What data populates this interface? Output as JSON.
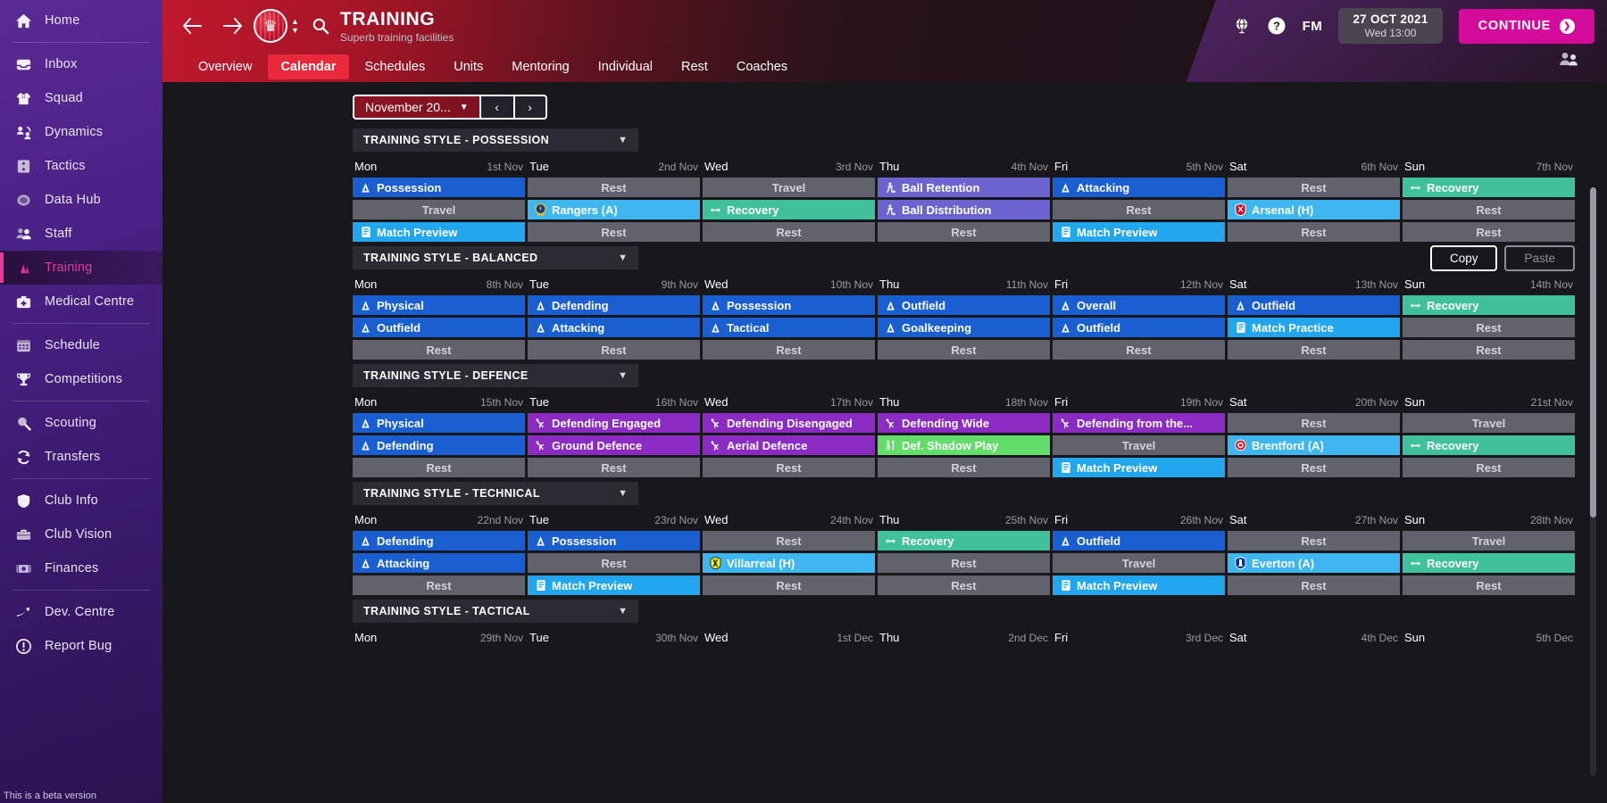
{
  "sidebar": {
    "items": [
      {
        "label": "Home",
        "icon": "home-icon",
        "active": false
      },
      {
        "divider": true
      },
      {
        "label": "Inbox",
        "icon": "inbox-icon",
        "active": false
      },
      {
        "label": "Squad",
        "icon": "shirt-icon",
        "active": false
      },
      {
        "label": "Dynamics",
        "icon": "dynamics-icon",
        "active": false
      },
      {
        "label": "Tactics",
        "icon": "tactics-icon",
        "active": false
      },
      {
        "label": "Data Hub",
        "icon": "datahub-icon",
        "active": false
      },
      {
        "label": "Staff",
        "icon": "staff-icon",
        "active": false
      },
      {
        "label": "Training",
        "icon": "training-icon",
        "active": true
      },
      {
        "label": "Medical Centre",
        "icon": "medical-icon",
        "active": false
      },
      {
        "divider": true
      },
      {
        "label": "Schedule",
        "icon": "calendar-icon",
        "active": false
      },
      {
        "label": "Competitions",
        "icon": "trophy-icon",
        "active": false
      },
      {
        "divider": true
      },
      {
        "label": "Scouting",
        "icon": "magnifier-icon",
        "active": false
      },
      {
        "label": "Transfers",
        "icon": "transfer-icon",
        "active": false
      },
      {
        "divider": true
      },
      {
        "label": "Club Info",
        "icon": "shield-icon",
        "active": false
      },
      {
        "label": "Club Vision",
        "icon": "briefcase-icon",
        "active": false
      },
      {
        "label": "Finances",
        "icon": "money-icon",
        "active": false
      },
      {
        "divider": true
      },
      {
        "label": "Dev. Centre",
        "icon": "growth-icon",
        "active": false
      },
      {
        "label": "Report Bug",
        "icon": "bug-icon",
        "active": false
      }
    ],
    "beta_note": "This is a beta version"
  },
  "header": {
    "back_icon": "back-arrow-icon",
    "forward_icon": "forward-arrow-icon",
    "club_badge": "club-crest-icon",
    "search_icon": "search-icon",
    "title": "TRAINING",
    "subtitle": "Superb training facilities",
    "globe_icon": "globe-icon",
    "help_icon": "help-icon",
    "fm_logo": "FM",
    "date_main": "27 OCT 2021",
    "date_sub": "Wed 13:00",
    "continue_label": "CONTINUE",
    "continue_color": "#d40b9a",
    "people_icon": "people-icon",
    "tabs": [
      {
        "label": "Overview",
        "active": false
      },
      {
        "label": "Calendar",
        "active": true
      },
      {
        "label": "Schedules",
        "active": false
      },
      {
        "label": "Units",
        "active": false
      },
      {
        "label": "Mentoring",
        "active": false
      },
      {
        "label": "Individual",
        "active": false
      },
      {
        "label": "Rest",
        "active": false
      },
      {
        "label": "Coaches",
        "active": false
      }
    ]
  },
  "toolbar": {
    "month_value": "November 20...",
    "month_chevron": "chevron-down-icon",
    "prev_label": "‹",
    "next_label": "›",
    "copy_label": "Copy",
    "paste_label": "Paste"
  },
  "weeks": [
    {
      "title": "TRAINING STYLE - POSSESSION",
      "days": [
        {
          "dow": "Mon",
          "date": "1st Nov"
        },
        {
          "dow": "Tue",
          "date": "2nd Nov"
        },
        {
          "dow": "Wed",
          "date": "3rd Nov"
        },
        {
          "dow": "Thu",
          "date": "4th Nov"
        },
        {
          "dow": "Fri",
          "date": "5th Nov"
        },
        {
          "dow": "Sat",
          "date": "6th Nov"
        },
        {
          "dow": "Sun",
          "date": "7th Nov"
        }
      ],
      "columns": [
        [
          {
            "label": "Possession",
            "kind": "blue",
            "icon": "cone-icon"
          },
          {
            "label": "Travel",
            "kind": "travel",
            "icon": ""
          },
          {
            "label": "Match Preview",
            "kind": "preview",
            "icon": "clipboard-icon"
          }
        ],
        [
          {
            "label": "Rest",
            "kind": "rest",
            "icon": ""
          },
          {
            "label": "Rangers (A)",
            "kind": "match",
            "icon": "badge-rangers"
          },
          {
            "label": "Rest",
            "kind": "rest",
            "icon": ""
          }
        ],
        [
          {
            "label": "Travel",
            "kind": "travel",
            "icon": ""
          },
          {
            "label": "Recovery",
            "kind": "green",
            "icon": "recovery-icon"
          },
          {
            "label": "Rest",
            "kind": "rest",
            "icon": ""
          }
        ],
        [
          {
            "label": "Ball Retention",
            "kind": "purple",
            "icon": "player-icon"
          },
          {
            "label": "Ball Distribution",
            "kind": "purple",
            "icon": "player-icon"
          },
          {
            "label": "Rest",
            "kind": "rest",
            "icon": ""
          }
        ],
        [
          {
            "label": "Attacking",
            "kind": "blue",
            "icon": "cone-icon"
          },
          {
            "label": "Rest",
            "kind": "rest",
            "icon": ""
          },
          {
            "label": "Match Preview",
            "kind": "preview",
            "icon": "clipboard-icon"
          }
        ],
        [
          {
            "label": "Rest",
            "kind": "rest",
            "icon": ""
          },
          {
            "label": "Arsenal (H)",
            "kind": "match",
            "icon": "badge-arsenal"
          },
          {
            "label": "Rest",
            "kind": "rest",
            "icon": ""
          }
        ],
        [
          {
            "label": "Recovery",
            "kind": "green",
            "icon": "recovery-icon"
          },
          {
            "label": "Rest",
            "kind": "rest",
            "icon": ""
          },
          {
            "label": "Rest",
            "kind": "rest",
            "icon": ""
          }
        ]
      ]
    },
    {
      "title": "TRAINING STYLE - BALANCED",
      "days": [
        {
          "dow": "Mon",
          "date": "8th Nov"
        },
        {
          "dow": "Tue",
          "date": "9th Nov"
        },
        {
          "dow": "Wed",
          "date": "10th Nov"
        },
        {
          "dow": "Thu",
          "date": "11th Nov"
        },
        {
          "dow": "Fri",
          "date": "12th Nov"
        },
        {
          "dow": "Sat",
          "date": "13th Nov"
        },
        {
          "dow": "Sun",
          "date": "14th Nov"
        }
      ],
      "columns": [
        [
          {
            "label": "Physical",
            "kind": "blue",
            "icon": "cone-icon"
          },
          {
            "label": "Outfield",
            "kind": "blue",
            "icon": "cone-icon"
          },
          {
            "label": "Rest",
            "kind": "rest",
            "icon": ""
          }
        ],
        [
          {
            "label": "Defending",
            "kind": "blue",
            "icon": "cone-icon"
          },
          {
            "label": "Attacking",
            "kind": "blue",
            "icon": "cone-icon"
          },
          {
            "label": "Rest",
            "kind": "rest",
            "icon": ""
          }
        ],
        [
          {
            "label": "Possession",
            "kind": "blue",
            "icon": "cone-icon"
          },
          {
            "label": "Tactical",
            "kind": "blue",
            "icon": "cone-icon"
          },
          {
            "label": "Rest",
            "kind": "rest",
            "icon": ""
          }
        ],
        [
          {
            "label": "Outfield",
            "kind": "blue",
            "icon": "cone-icon"
          },
          {
            "label": "Goalkeeping",
            "kind": "blue",
            "icon": "cone-icon"
          },
          {
            "label": "Rest",
            "kind": "rest",
            "icon": ""
          }
        ],
        [
          {
            "label": "Overall",
            "kind": "blue",
            "icon": "cone-icon"
          },
          {
            "label": "Outfield",
            "kind": "blue",
            "icon": "cone-icon"
          },
          {
            "label": "Rest",
            "kind": "rest",
            "icon": ""
          }
        ],
        [
          {
            "label": "Outfield",
            "kind": "blue",
            "icon": "cone-icon"
          },
          {
            "label": "Match Practice",
            "kind": "practice",
            "icon": "clipboard-icon"
          },
          {
            "label": "Rest",
            "kind": "rest",
            "icon": ""
          }
        ],
        [
          {
            "label": "Recovery",
            "kind": "green",
            "icon": "recovery-icon"
          },
          {
            "label": "Rest",
            "kind": "rest",
            "icon": ""
          },
          {
            "label": "Rest",
            "kind": "rest",
            "icon": ""
          }
        ]
      ]
    },
    {
      "title": "TRAINING STYLE - DEFENCE",
      "days": [
        {
          "dow": "Mon",
          "date": "15th Nov"
        },
        {
          "dow": "Tue",
          "date": "16th Nov"
        },
        {
          "dow": "Wed",
          "date": "17th Nov"
        },
        {
          "dow": "Thu",
          "date": "18th Nov"
        },
        {
          "dow": "Fri",
          "date": "19th Nov"
        },
        {
          "dow": "Sat",
          "date": "20th Nov"
        },
        {
          "dow": "Sun",
          "date": "21st Nov"
        }
      ],
      "columns": [
        [
          {
            "label": "Physical",
            "kind": "blue",
            "icon": "cone-icon"
          },
          {
            "label": "Defending",
            "kind": "blue",
            "icon": "cone-icon"
          },
          {
            "label": "Rest",
            "kind": "rest",
            "icon": ""
          }
        ],
        [
          {
            "label": "Defending Engaged",
            "kind": "violet",
            "icon": "defender-icon"
          },
          {
            "label": "Ground Defence",
            "kind": "violet",
            "icon": "defender-icon"
          },
          {
            "label": "Rest",
            "kind": "rest",
            "icon": ""
          }
        ],
        [
          {
            "label": "Defending Disengaged",
            "kind": "violet",
            "icon": "defender-icon"
          },
          {
            "label": "Aerial Defence",
            "kind": "violet",
            "icon": "defender-icon"
          },
          {
            "label": "Rest",
            "kind": "rest",
            "icon": ""
          }
        ],
        [
          {
            "label": "Defending Wide",
            "kind": "violet",
            "icon": "defender-icon"
          },
          {
            "label": "Def. Shadow Play",
            "kind": "lgreen",
            "icon": "shadow-icon"
          },
          {
            "label": "Rest",
            "kind": "rest",
            "icon": ""
          }
        ],
        [
          {
            "label": "Defending from the...",
            "kind": "violet",
            "icon": "defender-icon"
          },
          {
            "label": "Travel",
            "kind": "travel",
            "icon": ""
          },
          {
            "label": "Match Preview",
            "kind": "preview",
            "icon": "clipboard-icon"
          }
        ],
        [
          {
            "label": "Rest",
            "kind": "rest",
            "icon": ""
          },
          {
            "label": "Brentford (A)",
            "kind": "match",
            "icon": "badge-brentford"
          },
          {
            "label": "Rest",
            "kind": "rest",
            "icon": ""
          }
        ],
        [
          {
            "label": "Travel",
            "kind": "travel",
            "icon": ""
          },
          {
            "label": "Recovery",
            "kind": "green",
            "icon": "recovery-icon"
          },
          {
            "label": "Rest",
            "kind": "rest",
            "icon": ""
          }
        ]
      ]
    },
    {
      "title": "TRAINING STYLE - TECHNICAL",
      "days": [
        {
          "dow": "Mon",
          "date": "22nd Nov"
        },
        {
          "dow": "Tue",
          "date": "23rd Nov"
        },
        {
          "dow": "Wed",
          "date": "24th Nov"
        },
        {
          "dow": "Thu",
          "date": "25th Nov"
        },
        {
          "dow": "Fri",
          "date": "26th Nov"
        },
        {
          "dow": "Sat",
          "date": "27th Nov"
        },
        {
          "dow": "Sun",
          "date": "28th Nov"
        }
      ],
      "columns": [
        [
          {
            "label": "Defending",
            "kind": "blue",
            "icon": "cone-icon"
          },
          {
            "label": "Attacking",
            "kind": "blue",
            "icon": "cone-icon"
          },
          {
            "label": "Rest",
            "kind": "rest",
            "icon": ""
          }
        ],
        [
          {
            "label": "Possession",
            "kind": "blue",
            "icon": "cone-icon"
          },
          {
            "label": "Rest",
            "kind": "rest",
            "icon": ""
          },
          {
            "label": "Match Preview",
            "kind": "preview",
            "icon": "clipboard-icon"
          }
        ],
        [
          {
            "label": "Rest",
            "kind": "rest",
            "icon": ""
          },
          {
            "label": "Villarreal (H)",
            "kind": "match",
            "icon": "badge-villarreal"
          },
          {
            "label": "Rest",
            "kind": "rest",
            "icon": ""
          }
        ],
        [
          {
            "label": "Recovery",
            "kind": "green",
            "icon": "recovery-icon"
          },
          {
            "label": "Rest",
            "kind": "rest",
            "icon": ""
          },
          {
            "label": "Rest",
            "kind": "rest",
            "icon": ""
          }
        ],
        [
          {
            "label": "Outfield",
            "kind": "blue",
            "icon": "cone-icon"
          },
          {
            "label": "Travel",
            "kind": "travel",
            "icon": ""
          },
          {
            "label": "Match Preview",
            "kind": "preview",
            "icon": "clipboard-icon"
          }
        ],
        [
          {
            "label": "Rest",
            "kind": "rest",
            "icon": ""
          },
          {
            "label": "Everton (A)",
            "kind": "match",
            "icon": "badge-everton"
          },
          {
            "label": "Rest",
            "kind": "rest",
            "icon": ""
          }
        ],
        [
          {
            "label": "Travel",
            "kind": "travel",
            "icon": ""
          },
          {
            "label": "Recovery",
            "kind": "green",
            "icon": "recovery-icon"
          },
          {
            "label": "Rest",
            "kind": "rest",
            "icon": ""
          }
        ]
      ]
    },
    {
      "title": "TRAINING STYLE - TACTICAL",
      "days": [
        {
          "dow": "Mon",
          "date": "29th Nov"
        },
        {
          "dow": "Tue",
          "date": "30th Nov"
        },
        {
          "dow": "Wed",
          "date": "1st Dec"
        },
        {
          "dow": "Thu",
          "date": "2nd Dec"
        },
        {
          "dow": "Fri",
          "date": "3rd Dec"
        },
        {
          "dow": "Sat",
          "date": "4th Dec"
        },
        {
          "dow": "Sun",
          "date": "5th Dec"
        }
      ],
      "columns": [
        [],
        [],
        [],
        [],
        [],
        [],
        []
      ]
    }
  ]
}
